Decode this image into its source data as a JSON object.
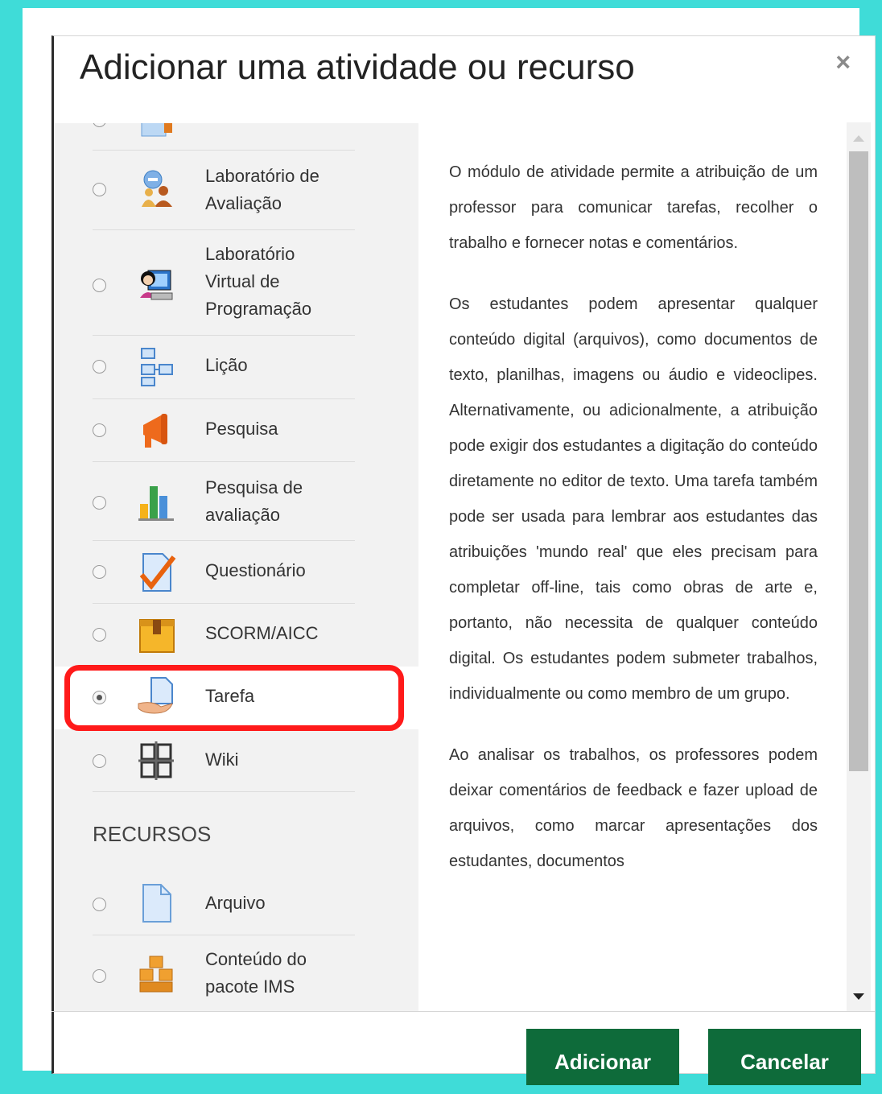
{
  "dialog": {
    "title": "Adicionar uma atividade ou recurso",
    "close_symbol": "×"
  },
  "activities": [
    {
      "label": "Laboratório de\nAvaliação",
      "icon": "workshop-icon",
      "selected": false
    },
    {
      "label": "Laboratório\nVirtual de\nProgramação",
      "icon": "vpl-icon",
      "selected": false
    },
    {
      "label": "Lição",
      "icon": "lesson-icon",
      "selected": false
    },
    {
      "label": "Pesquisa",
      "icon": "survey-megaphone-icon",
      "selected": false
    },
    {
      "label": "Pesquisa de\navaliação",
      "icon": "feedback-chart-icon",
      "selected": false
    },
    {
      "label": "Questionário",
      "icon": "quiz-check-icon",
      "selected": false
    },
    {
      "label": "SCORM/AICC",
      "icon": "scorm-box-icon",
      "selected": false
    },
    {
      "label": "Tarefa",
      "icon": "assignment-icon",
      "selected": true
    },
    {
      "label": "Wiki",
      "icon": "wiki-icon",
      "selected": false
    }
  ],
  "resources_section": "RECURSOS",
  "resources": [
    {
      "label": "Arquivo",
      "icon": "file-icon",
      "selected": false
    },
    {
      "label": "Conteúdo do\npacote IMS",
      "icon": "ims-package-icon",
      "selected": false
    }
  ],
  "description": [
    "O módulo de atividade permite a atribuição de um professor para comunicar tarefas, recolher o trabalho e fornecer notas e comentários.",
    "Os estudantes podem apresentar qualquer conteúdo digital (arquivos), como documentos de texto, planilhas, imagens ou áudio e videoclipes. Alternativamente, ou adicionalmente, a atribuição pode exigir dos estudantes a digitação do conteúdo diretamente no editor de texto. Uma tarefa também pode ser usada para lembrar aos estudantes das atribuições 'mundo real' que eles precisam para completar off-line, tais como obras de arte e, portanto, não necessita de qualquer conteúdo digital. Os estudantes podem submeter trabalhos, individualmente ou como membro de um grupo.",
    "Ao analisar os trabalhos, os professores podem deixar comentários de feedback e fazer upload de arquivos, como marcar apresentações dos estudantes, documentos"
  ],
  "buttons": {
    "add": "Adicionar",
    "cancel": "Cancelar"
  },
  "colors": {
    "background": "#3fdcd8",
    "button": "#0e6b3a",
    "highlight": "#ff1a1a"
  }
}
